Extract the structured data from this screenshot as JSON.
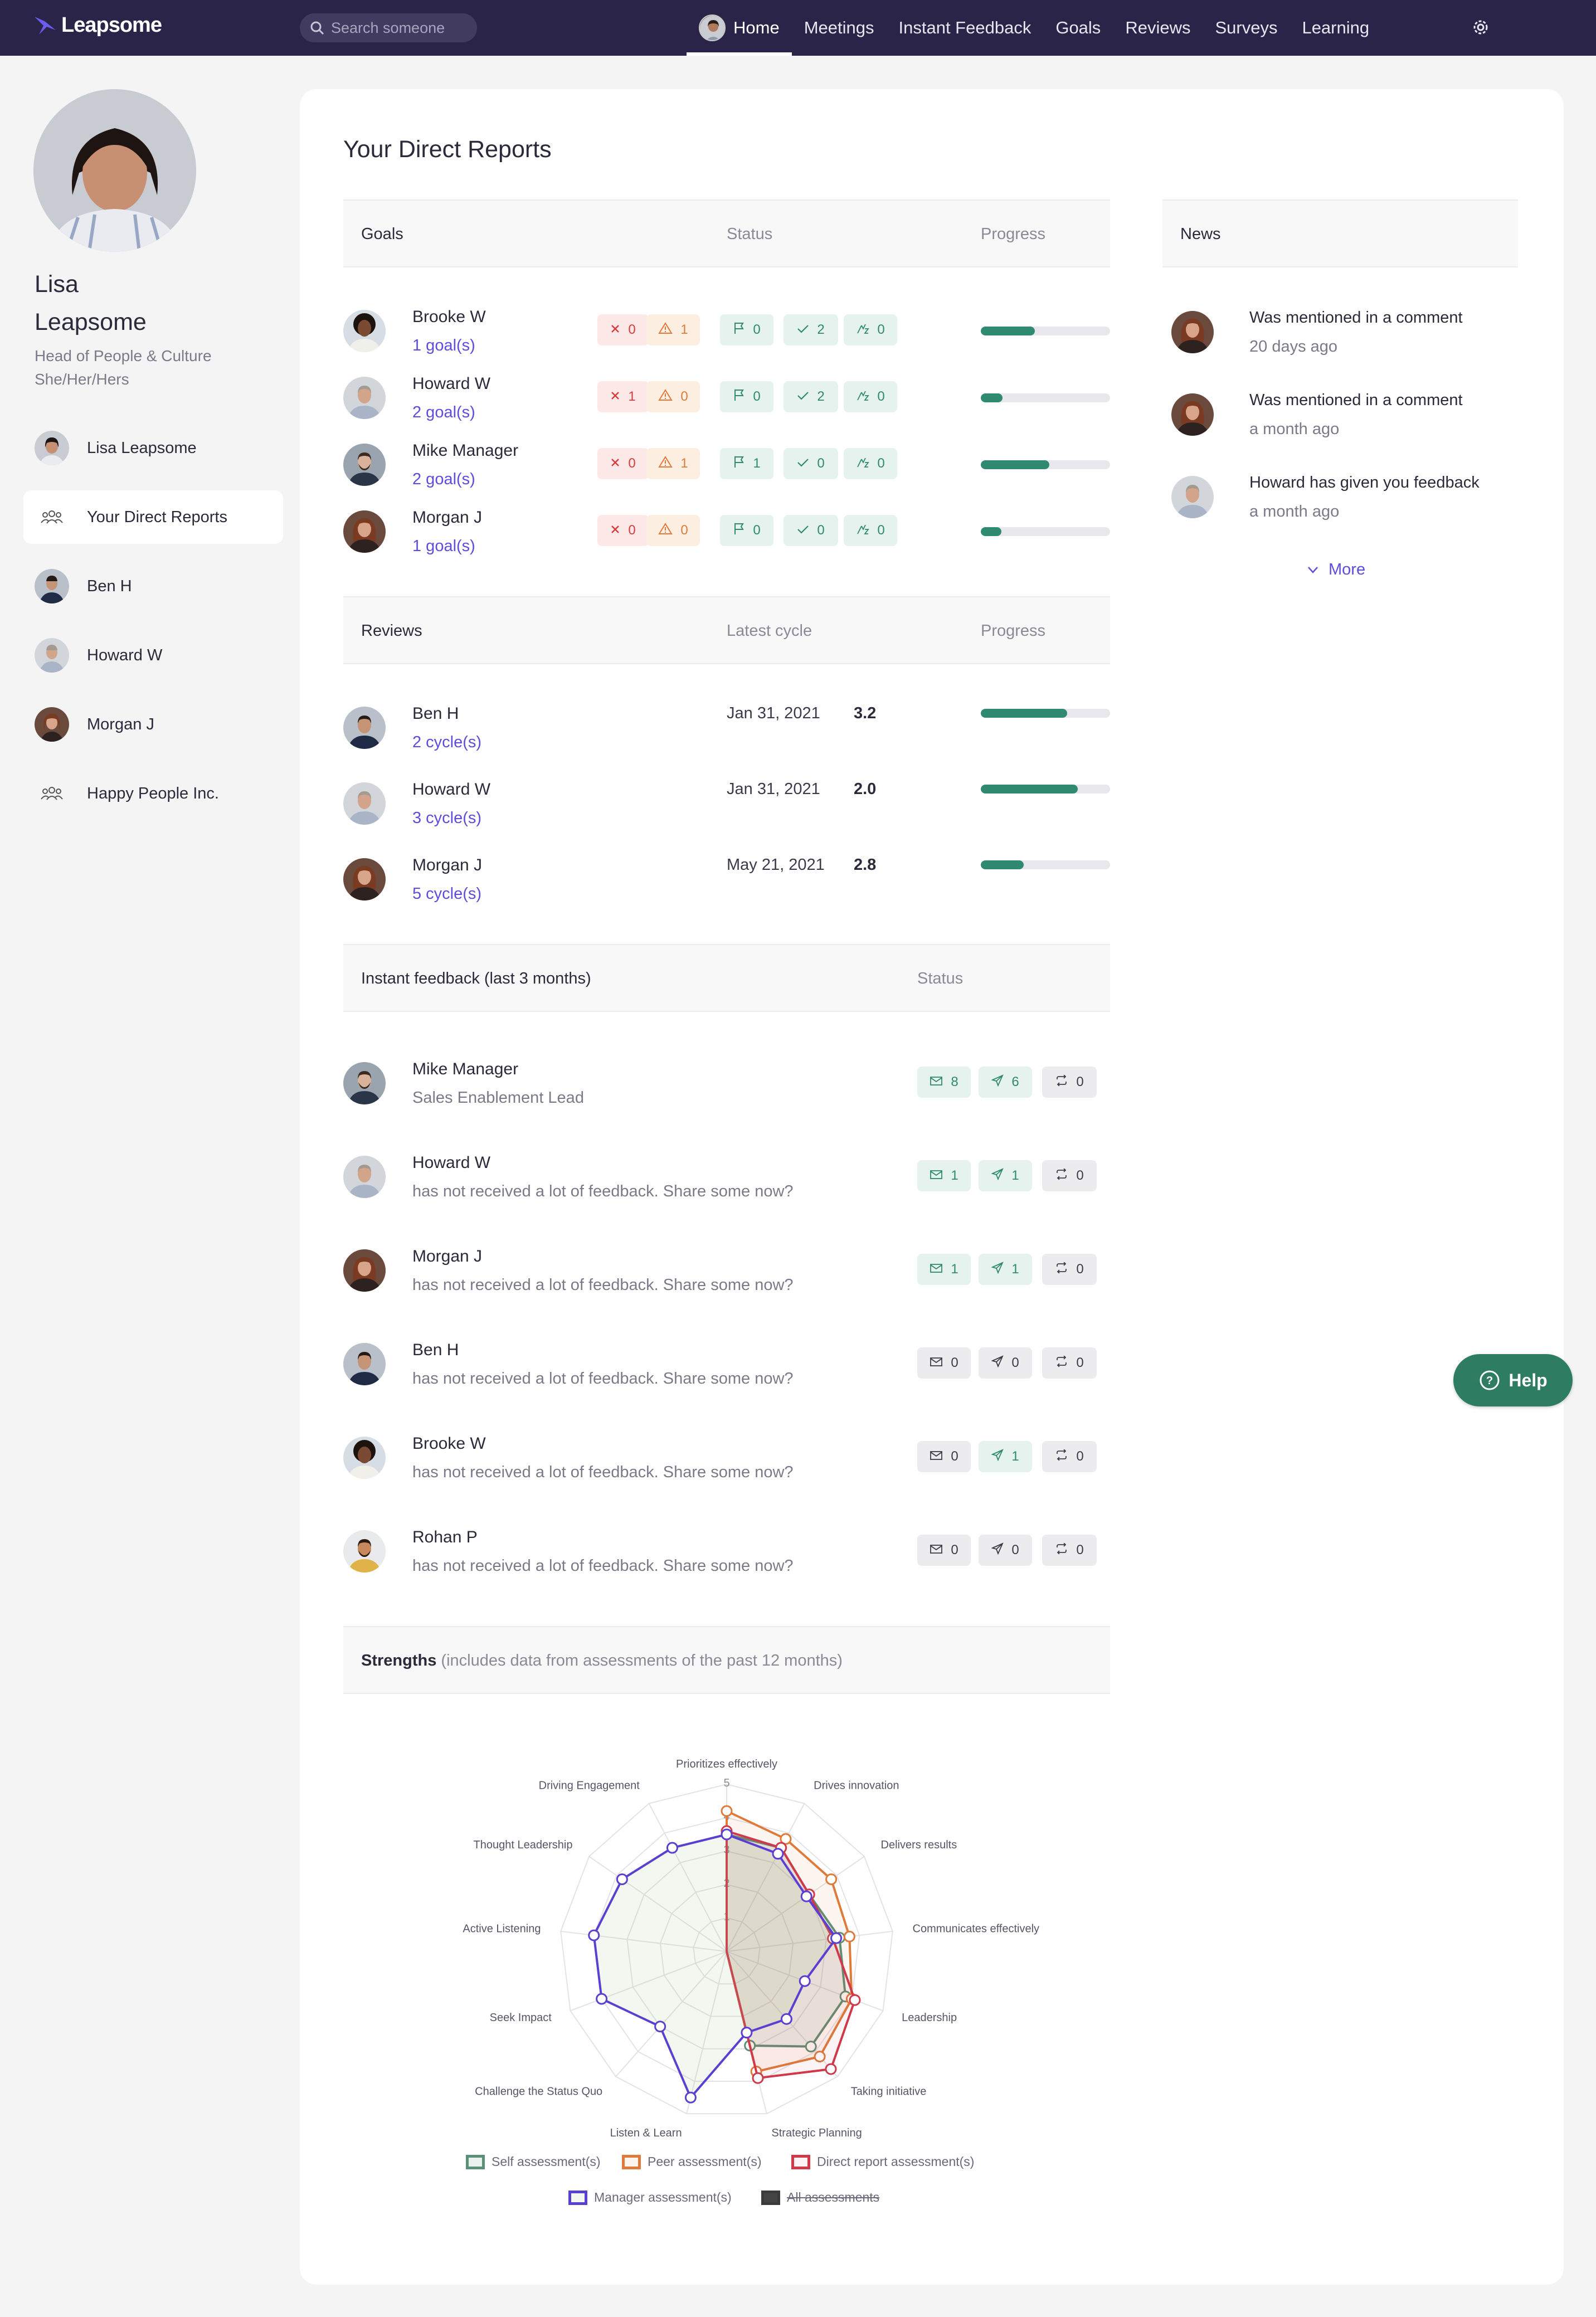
{
  "topbar": {
    "brand": "Leapsome",
    "search_placeholder": "Search someone",
    "nav": [
      "Home",
      "Meetings",
      "Instant Feedback",
      "Goals",
      "Reviews",
      "Surveys",
      "Learning"
    ]
  },
  "profile": {
    "first_name": "Lisa",
    "last_name": "Leapsome",
    "role": "Head of People & Culture",
    "pronouns": "She/Her/Hers"
  },
  "sidebar": {
    "items": [
      {
        "label": "Lisa Leapsome",
        "icon": "avatar"
      },
      {
        "label": "Your Direct Reports",
        "icon": "group-icon"
      },
      {
        "label": "Ben H",
        "icon": "avatar"
      },
      {
        "label": "Howard W",
        "icon": "avatar"
      },
      {
        "label": "Morgan J",
        "icon": "avatar"
      },
      {
        "label": "Happy People Inc.",
        "icon": "group-icon"
      }
    ]
  },
  "main": {
    "title": "Your Direct Reports",
    "goals": {
      "header": {
        "col1": "Goals",
        "col2": "Status",
        "col3": "Progress"
      },
      "rows": [
        {
          "name": "Brooke W",
          "link": "1 goal(s)",
          "status": [
            "0",
            "1",
            "0",
            "2",
            "0"
          ],
          "progress": 0.42
        },
        {
          "name": "Howard W",
          "link": "2 goal(s)",
          "status": [
            "1",
            "0",
            "0",
            "2",
            "0"
          ],
          "progress": 0.17
        },
        {
          "name": "Mike Manager",
          "link": "2 goal(s)",
          "status": [
            "0",
            "1",
            "1",
            "0",
            "0"
          ],
          "progress": 0.53
        },
        {
          "name": "Morgan J",
          "link": "1 goal(s)",
          "status": [
            "0",
            "0",
            "0",
            "0",
            "0"
          ],
          "progress": 0.16
        }
      ]
    },
    "reviews": {
      "header": {
        "col1": "Reviews",
        "col2": "Latest cycle",
        "col3": "Progress"
      },
      "rows": [
        {
          "name": "Ben H",
          "link": "2 cycle(s)",
          "date": "Jan 31, 2021",
          "score": "3.2",
          "progress": 0.67
        },
        {
          "name": "Howard W",
          "link": "3 cycle(s)",
          "date": "Jan 31, 2021",
          "score": "2.0",
          "progress": 0.75
        },
        {
          "name": "Morgan J",
          "link": "5 cycle(s)",
          "date": "May 21, 2021",
          "score": "2.8",
          "progress": 0.33
        }
      ]
    },
    "feedback": {
      "header": {
        "col1": "Instant feedback (last 3 months)",
        "col2": "Status"
      },
      "rows": [
        {
          "name": "Mike Manager",
          "sub": "Sales Enablement Lead",
          "counts": [
            "8",
            "6",
            "0"
          ],
          "colors": [
            "grn",
            "grn",
            "gry"
          ]
        },
        {
          "name": "Howard W",
          "sub": "has not received a lot of feedback. Share some now?",
          "counts": [
            "1",
            "1",
            "0"
          ],
          "colors": [
            "grn",
            "grn",
            "gry"
          ]
        },
        {
          "name": "Morgan J",
          "sub": "has not received a lot of feedback. Share some now?",
          "counts": [
            "1",
            "1",
            "0"
          ],
          "colors": [
            "grn",
            "grn",
            "gry"
          ]
        },
        {
          "name": "Ben H",
          "sub": "has not received a lot of feedback. Share some now?",
          "counts": [
            "0",
            "0",
            "0"
          ],
          "colors": [
            "gry",
            "gry",
            "gry"
          ]
        },
        {
          "name": "Brooke W",
          "sub": "has not received a lot of feedback. Share some now?",
          "counts": [
            "0",
            "1",
            "0"
          ],
          "colors": [
            "gry",
            "grn",
            "gry"
          ]
        },
        {
          "name": "Rohan P",
          "sub": "has not received a lot of feedback. Share some now?",
          "counts": [
            "0",
            "0",
            "0"
          ],
          "colors": [
            "gry",
            "gry",
            "gry"
          ]
        }
      ]
    },
    "strengths": {
      "title": "Strengths",
      "note": "(includes data from assessments of the past 12 months)"
    }
  },
  "news": {
    "header": "News",
    "items": [
      {
        "text": "Was mentioned in a comment",
        "time": "20 days ago"
      },
      {
        "text": "Was mentioned in a comment",
        "time": "a month ago"
      },
      {
        "text": "Howard has given you feedback",
        "time": "a month ago"
      }
    ],
    "more": "More"
  },
  "help": "Help",
  "chart_data": {
    "type": "radar",
    "categories": [
      "Prioritizes effectively",
      "Drives innovation",
      "Delivers results",
      "Communicates effectively",
      "Leadership",
      "Taking initiative",
      "Strategic Planning",
      "Listen & Learn",
      "Challenge the Status Quo",
      "Seek Impact",
      "Active Listening",
      "Thought Leadership",
      "Driving Engagement"
    ],
    "ticks": [
      "1",
      "2",
      "3",
      "4",
      "5"
    ],
    "rmax": 5,
    "series": [
      {
        "name": "Self assessment(s)",
        "color": "#5b8f78",
        "values": [
          3.5,
          3.5,
          3.0,
          3.4,
          3.8,
          3.8,
          2.9,
          null,
          null,
          null,
          null,
          null,
          null
        ]
      },
      {
        "name": "Peer assessment(s)",
        "color": "#e07a3a",
        "values": [
          4.2,
          3.8,
          3.8,
          3.7,
          4.0,
          4.2,
          3.7,
          null,
          null,
          null,
          null,
          null,
          null
        ]
      },
      {
        "name": "Direct report assessment(s)",
        "color": "#d0394a",
        "values": [
          3.6,
          3.5,
          3.0,
          3.2,
          4.1,
          4.7,
          3.9,
          null,
          null,
          null,
          null,
          null,
          null
        ]
      },
      {
        "name": "Manager assessment(s)",
        "color": "#5b3fd0",
        "values": [
          3.5,
          3.3,
          2.9,
          3.3,
          2.5,
          2.7,
          2.5,
          4.5,
          3.0,
          4.0,
          4.0,
          3.8,
          3.5
        ]
      },
      {
        "name": "All assessments",
        "color": "#3a3a3a",
        "hidden": true
      }
    ]
  }
}
